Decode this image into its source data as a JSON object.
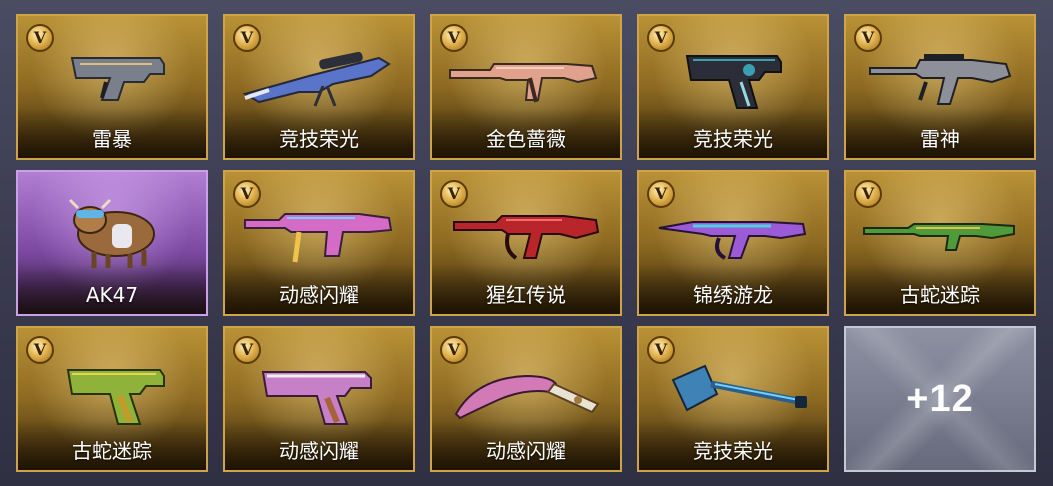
{
  "items": [
    {
      "label": "雷暴",
      "badge": "V",
      "icon": "pistol-icon",
      "accent": "#7a7f8c"
    },
    {
      "label": "竞技荣光",
      "badge": "V",
      "icon": "sniper-rifle-icon",
      "accent": "#5a74c9"
    },
    {
      "label": "金色蔷薇",
      "badge": "V",
      "icon": "assault-rifle-icon",
      "accent": "#e0a28c"
    },
    {
      "label": "竞技荣光",
      "badge": "V",
      "icon": "pistol-icon",
      "accent": "#3c9fb0"
    },
    {
      "label": "雷神",
      "badge": "V",
      "icon": "assault-rifle-icon",
      "accent": "#8d9099"
    },
    {
      "label": "AK47",
      "badge": "",
      "icon": "bull-mascot-icon",
      "accent": "#9a6a3c"
    },
    {
      "label": "动感闪耀",
      "badge": "V",
      "icon": "smg-icon",
      "accent": "#d46bc7"
    },
    {
      "label": "猩红传说",
      "badge": "V",
      "icon": "rifle-icon",
      "accent": "#b8262b"
    },
    {
      "label": "锦绣游龙",
      "badge": "V",
      "icon": "rifle-icon",
      "accent": "#9b5bd6"
    },
    {
      "label": "古蛇迷踪",
      "badge": "V",
      "icon": "rifle-icon",
      "accent": "#4f9a3a"
    },
    {
      "label": "古蛇迷踪",
      "badge": "V",
      "icon": "pistol-icon",
      "accent": "#8fb33a"
    },
    {
      "label": "动感闪耀",
      "badge": "V",
      "icon": "pistol-icon",
      "accent": "#c780c7"
    },
    {
      "label": "动感闪耀",
      "badge": "V",
      "icon": "machete-icon",
      "accent": "#d27ab5"
    },
    {
      "label": "竞技荣光",
      "badge": "V",
      "icon": "shovel-icon",
      "accent": "#3f82b5"
    }
  ],
  "more": {
    "label": "+12"
  }
}
